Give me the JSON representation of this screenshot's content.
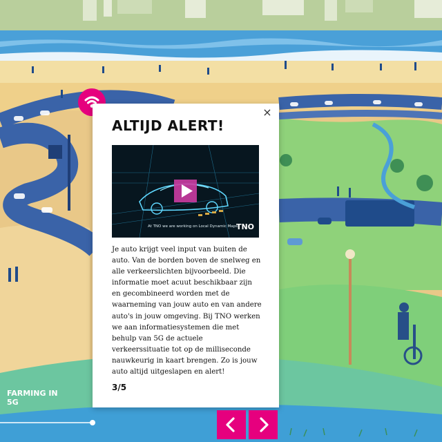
{
  "modal": {
    "title": "ALTIJD ALERT!",
    "close_label": "×",
    "video": {
      "caption": "At TNO we are working on Local Dynamic Maps:",
      "brand": "TNO"
    },
    "body": "Je auto krijgt veel input van buiten de auto. Van de borden boven de snelweg en alle verkeerslichten bijvoorbeeld. Die informatie moet acuut beschikbaar zijn en gecombineerd worden met de waarneming van jouw auto en van andere auto's in jouw omgeving. Bij TNO werken we aan informatiesystemen die met behulp van 5G de actuele verkeerssituatie tot op de milliseconde nauwkeurig in kaart brengen. Zo is jouw auto altijd uitgeslapen en alert!",
    "counter": "3/5"
  },
  "section_label": "FARMING IN 5G",
  "icons": {
    "badge": "wifi-icon",
    "prev": "chevron-left-icon",
    "next": "chevron-right-icon",
    "play": "play-icon",
    "close": "close-icon"
  },
  "colors": {
    "accent": "#e6007e",
    "sand": "#f3dfa4",
    "water": "#4aa0d8",
    "grass": "#8fd27a",
    "road": "#3a63a8"
  }
}
